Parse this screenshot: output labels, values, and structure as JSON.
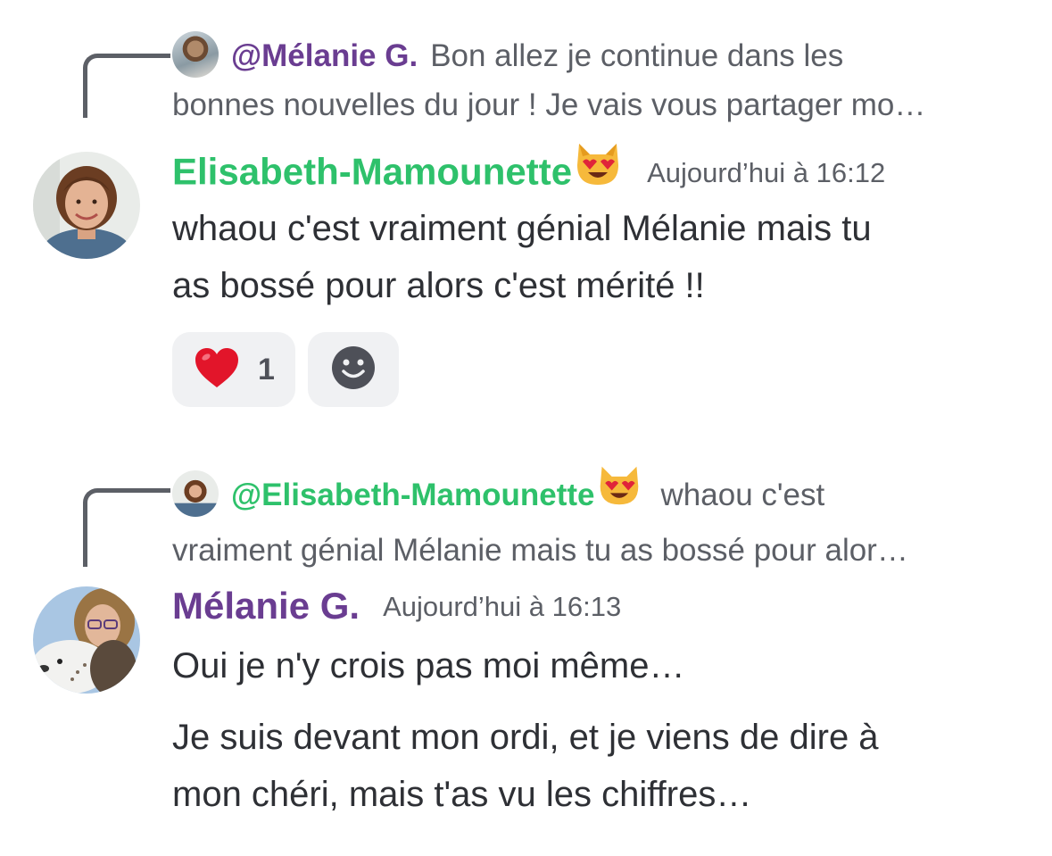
{
  "messages": [
    {
      "reply": {
        "mention": "@Mélanie G.",
        "mention_color": "#6a3d91",
        "excerpt_line1": "Bon allez je continue dans les",
        "excerpt_line2": "bonnes nouvelles du jour ! Je vais vous partager mo…"
      },
      "author": "Elisabeth-Mamounette",
      "author_color": "#2ec16b",
      "author_emoji": "smiling-cat-heart-eyes-emoji",
      "timestamp": "Aujourd’hui à 16:12",
      "body_line1": "whaou c'est vraiment génial Mélanie mais tu",
      "body_line2": "as bossé pour alors c'est mérité !!",
      "reactions": [
        {
          "emoji": "heart-emoji",
          "count": "1"
        }
      ],
      "add_reaction_icon": "smiley-face-icon"
    },
    {
      "reply": {
        "mention": "@Elisabeth-Mamounette",
        "mention_color": "#2ec16b",
        "excerpt_line1": "whaou c'est",
        "excerpt_line2": "vraiment génial Mélanie mais tu as bossé pour alor…"
      },
      "author": "Mélanie G.",
      "author_color": "#6a3d91",
      "timestamp": "Aujourd’hui à 16:13",
      "paragraph1": "Oui je n'y crois pas moi même…",
      "paragraph2_line1": "Je suis devant mon ordi, et je viens de dire à",
      "paragraph2_line2": "mon chéri, mais t'as vu les chiffres…"
    }
  ]
}
